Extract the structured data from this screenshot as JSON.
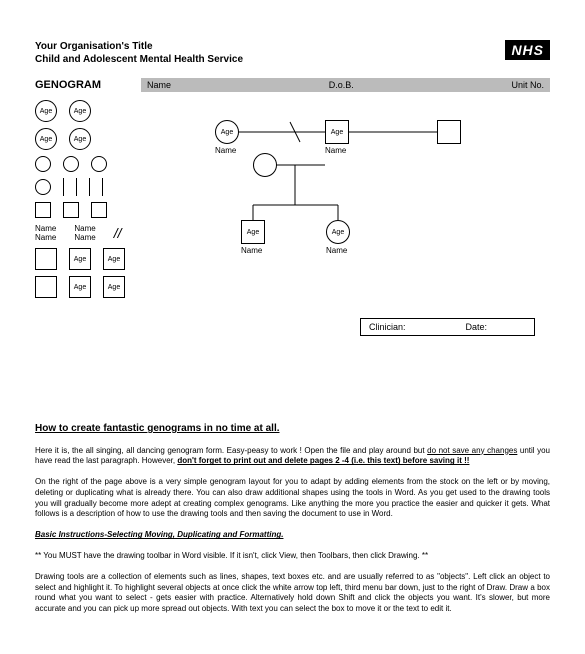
{
  "header": {
    "org_title": "Your Organisation's Title",
    "subtitle": "Child and Adolescent Mental Health Service",
    "logo": "NHS"
  },
  "title": "GENOGRAM",
  "fields": {
    "name": "Name",
    "dob": "D.o.B.",
    "unitno": "Unit No."
  },
  "stock": {
    "age": "Age",
    "name": "Name"
  },
  "diagram": {
    "age": "Age",
    "name": "Name"
  },
  "clinician_box": {
    "clinician": "Clinician:",
    "date": "Date:"
  },
  "instructions": {
    "heading": "How to create fantastic genograms in no time at all.",
    "p1a": "Here it is, the all singing, all dancing genogram form.  Easy-peasy to work ! Open the file and play around but ",
    "p1b": "do not save any changes",
    "p1c": " until you have read the last paragraph.  However, ",
    "p1d": "don't forget to print out and delete pages 2 -4  (i.e. this text) before saving it !!",
    "p2": "On the right of the page above is a very simple genogram layout for you to adapt by adding elements from the stock on the left or by moving, deleting or duplicating what is already there.  You can also draw additional shapes using the tools in Word.  As you get used to the drawing tools you will gradually become more adept at creating complex genograms.   Like anything the more you practice the easier and quicker it gets.  What follows is a description of how to use the drawing tools and then saving the document to use in Word.",
    "sub": "Basic Instructions-Selecting Moving, Duplicating and Formatting.",
    "p3": "** You MUST have the drawing toolbar in Word visible.  If it isn't, click View, then Toolbars, then click Drawing. **",
    "p4": "Drawing tools are a collection of elements such as lines, shapes, text boxes etc. and are usually referred to as \"objects\".  Left click an object to select and highlight it.  To highlight several objects at once click the white arrow top left, third menu bar down, just to the right of Draw.  Draw a box round what you want to select - gets easier with practice.  Alternatively hold down Shift and click the objects you want.  It's slower, but more accurate and you can pick up more spread out objects.  With text you can select the box to move it or the text to edit it."
  }
}
